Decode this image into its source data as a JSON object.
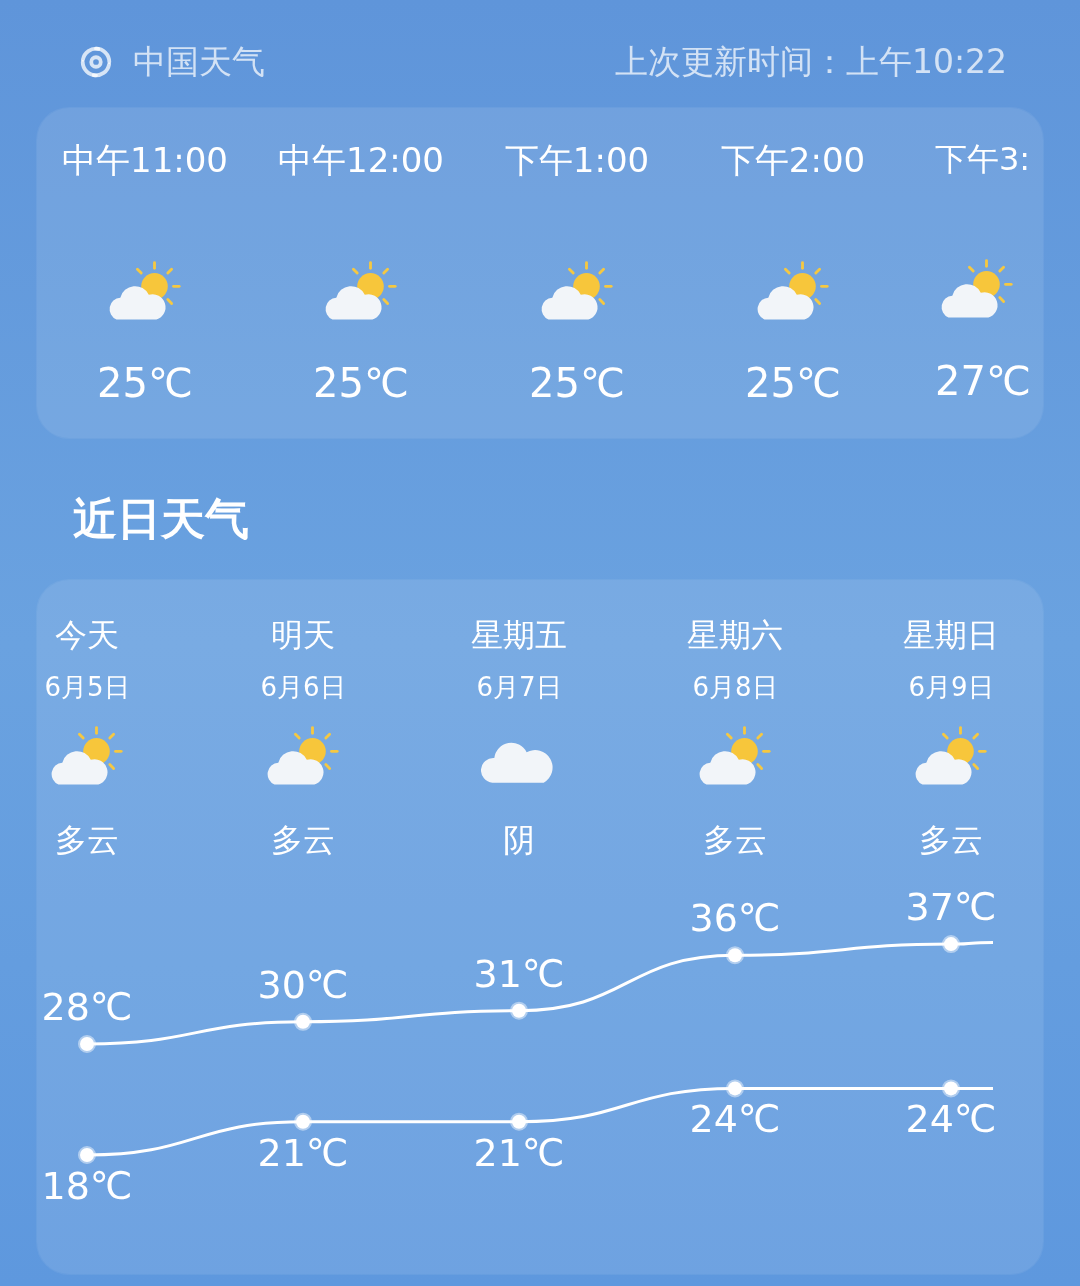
{
  "header": {
    "app_name": "中国天气",
    "updated": "上次更新时间：上午10:22"
  },
  "hourly": [
    {
      "time": "中午11:00",
      "kind": "partly-cloudy",
      "temp": "25℃"
    },
    {
      "time": "中午12:00",
      "kind": "partly-cloudy",
      "temp": "25℃"
    },
    {
      "time": "下午1:00",
      "kind": "partly-cloudy",
      "temp": "25℃"
    },
    {
      "time": "下午2:00",
      "kind": "partly-cloudy",
      "temp": "25℃"
    },
    {
      "time": "下午3:",
      "kind": "partly-cloudy",
      "temp": "27℃"
    }
  ],
  "section_title": "近日天气",
  "daily": [
    {
      "day": "今天",
      "date": "6月5日",
      "kind": "partly-cloudy",
      "condition": "多云"
    },
    {
      "day": "明天",
      "date": "6月6日",
      "kind": "partly-cloudy",
      "condition": "多云"
    },
    {
      "day": "星期五",
      "date": "6月7日",
      "kind": "cloudy",
      "condition": "阴"
    },
    {
      "day": "星期六",
      "date": "6月8日",
      "kind": "partly-cloudy",
      "condition": "多云"
    },
    {
      "day": "星期日",
      "date": "6月9日",
      "kind": "partly-cloudy",
      "condition": "多云"
    }
  ],
  "chart_data": {
    "type": "line",
    "data_labels": true,
    "series": [
      {
        "color": "#ffffff",
        "marker": "circle",
        "values": [
          28,
          30,
          31,
          36,
          37
        ],
        "value_labels": [
          "28℃",
          "30℃",
          "31℃",
          "36℃",
          "37℃"
        ]
      },
      {
        "color": "#ffffff",
        "marker": "circle",
        "values": [
          18,
          21,
          21,
          24,
          24
        ],
        "value_labels": [
          "18℃",
          "21℃",
          "21℃",
          "24℃",
          "24℃"
        ]
      }
    ]
  }
}
